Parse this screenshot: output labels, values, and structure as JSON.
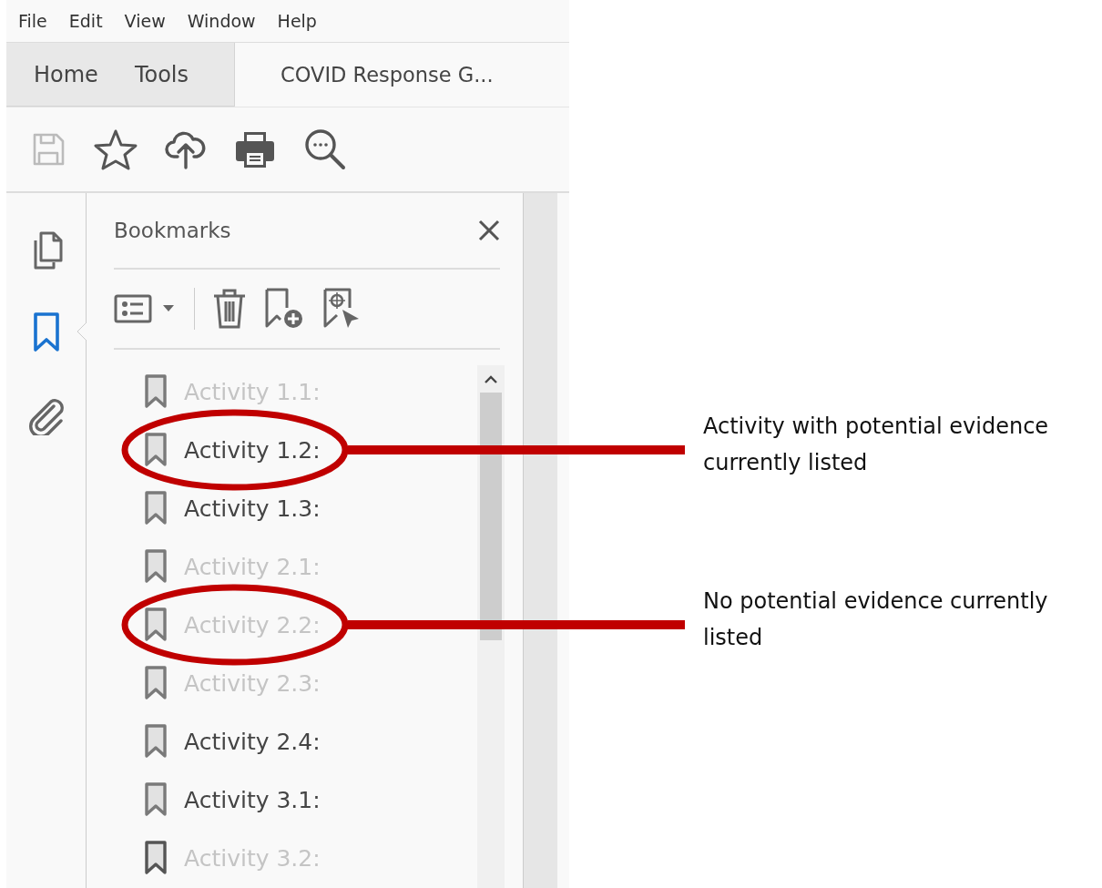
{
  "menu": [
    "File",
    "Edit",
    "View",
    "Window",
    "Help"
  ],
  "tabs": [
    {
      "label": "Home",
      "kind": "nav",
      "selected": false
    },
    {
      "label": "Tools",
      "kind": "nav",
      "selected": false
    },
    {
      "label": "COVID Response G...",
      "kind": "document",
      "selected": true
    }
  ],
  "toolbar": [
    {
      "kind": "save",
      "disabled": true
    },
    {
      "kind": "star",
      "disabled": false
    },
    {
      "kind": "upload",
      "disabled": false
    },
    {
      "kind": "print",
      "disabled": false
    },
    {
      "kind": "search",
      "disabled": false
    }
  ],
  "rail": [
    {
      "kind": "pages",
      "selected": false
    },
    {
      "kind": "bookmarks",
      "selected": true
    },
    {
      "kind": "attachments",
      "selected": false
    }
  ],
  "bookmarks_panel": {
    "title": "Bookmarks",
    "items": [
      {
        "label": "Activity 1.1:",
        "dimmed": true
      },
      {
        "label": "Activity 1.2:",
        "dimmed": false,
        "annotation": "Activity with potential evidence currently listed"
      },
      {
        "label": "Activity 1.3:",
        "dimmed": false
      },
      {
        "label": "Activity 2.1:",
        "dimmed": true
      },
      {
        "label": "Activity 2.2:",
        "dimmed": true,
        "annotation": "No potential evidence currently listed"
      },
      {
        "label": "Activity 2.3:",
        "dimmed": true
      },
      {
        "label": "Activity 2.4:",
        "dimmed": false
      },
      {
        "label": "Activity 3.1:",
        "dimmed": false
      },
      {
        "label": "Activity 3.2:",
        "dimmed": true
      }
    ]
  }
}
